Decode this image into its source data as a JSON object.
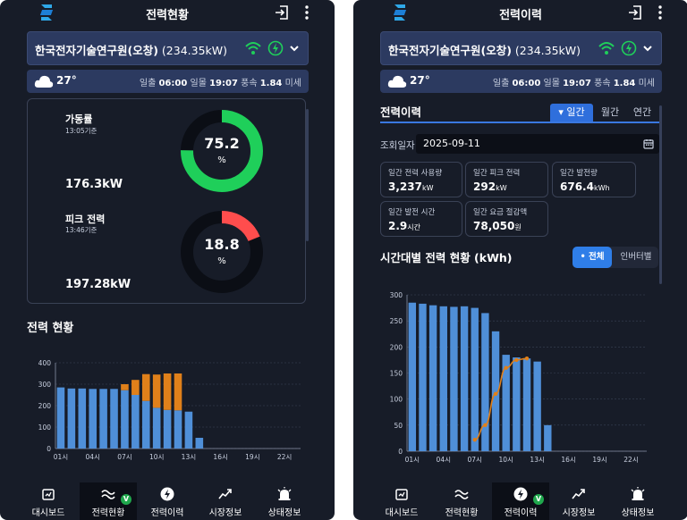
{
  "common": {
    "site_name_bold": "한국전자기술연구원(오창)",
    "site_capacity": " (234.35kW)",
    "temperature": "27°",
    "sunrise_label": "일출",
    "sunrise": "06:00",
    "sunset_label": "일몰",
    "sunset": "19:07",
    "wind_label": "풍속",
    "wind": "1.84",
    "dust_label": "미세",
    "colors": {
      "bg": "#171c28",
      "card": "#2c3a60",
      "accent": "#2f7ee8",
      "green": "#1fcf5a",
      "red": "#ff4d4d",
      "bar_blue": "#4f8fd8",
      "bar_orange": "#e0801a"
    }
  },
  "nav": {
    "items": [
      {
        "label": "대시보드",
        "icon": "dashboard-icon"
      },
      {
        "label": "전력현황",
        "icon": "power-wave-icon"
      },
      {
        "label": "전력이력",
        "icon": "bolt-icon"
      },
      {
        "label": "시장정보",
        "icon": "trend-icon"
      },
      {
        "label": "상태정보",
        "icon": "alarm-bell-icon"
      }
    ],
    "badge": "V"
  },
  "left": {
    "title": "전력현황",
    "uptime": {
      "label": "가동률",
      "time": "13:05기준",
      "value_text": "176.3kW",
      "percent": "75.2",
      "unit": "%",
      "fraction": 0.752
    },
    "peak": {
      "label": "피크 전력",
      "time": "13:46기준",
      "value_text": "197.28kW",
      "percent": "18.8",
      "unit": "%",
      "fraction": 0.188
    },
    "chart_title": "전력 현황"
  },
  "right": {
    "title": "전력이력",
    "section": "전력이력",
    "period_tabs": [
      "일간",
      "월간",
      "연간"
    ],
    "date_label": "조회일자",
    "date_value": "2025-09-11",
    "stats": [
      {
        "label": "일간 전력 사용량",
        "value": "3,237",
        "unit": "kW"
      },
      {
        "label": "일간 피크 전력",
        "value": "292",
        "unit": "kW"
      },
      {
        "label": "일간 발전량",
        "value": "676.4",
        "unit": "kWh"
      },
      {
        "label": "일간 발전 시간",
        "value": "2.9",
        "unit": "시간"
      },
      {
        "label": "일간 요금 절감액",
        "value": "78,050",
        "unit": "원"
      }
    ],
    "chart_title": "시간대별 전력 현황 (kWh)",
    "toggle": [
      "전체",
      "인버터별"
    ]
  },
  "chart_data": [
    {
      "type": "bar",
      "x": [
        "01시",
        "02시",
        "03시",
        "04시",
        "05시",
        "06시",
        "07시",
        "08시",
        "09시",
        "10시",
        "11시",
        "12시",
        "13시",
        "14시",
        "15시",
        "16시",
        "17시",
        "18시",
        "19시",
        "20시",
        "21시",
        "22시",
        "23시"
      ],
      "xticks": [
        "01시",
        "04시",
        "07시",
        "10시",
        "13시",
        "16시",
        "19시",
        "22시"
      ],
      "ylim": [
        0,
        400
      ],
      "yticks": [
        0,
        100,
        200,
        300,
        400
      ],
      "series": [
        {
          "values": [
            285,
            280,
            280,
            278,
            278,
            278,
            272,
            250,
            222,
            190,
            180,
            178,
            172,
            50,
            0,
            0,
            0,
            0,
            0,
            0,
            0,
            0,
            0
          ],
          "color": "#4f8fd8"
        },
        {
          "values": [
            0,
            0,
            0,
            0,
            0,
            0,
            28,
            70,
            125,
            155,
            170,
            172,
            0,
            0,
            0,
            0,
            0,
            0,
            0,
            0,
            0,
            0,
            0
          ],
          "color": "#e0801a"
        }
      ]
    },
    {
      "type": "bar",
      "x": [
        "01시",
        "02시",
        "03시",
        "04시",
        "05시",
        "06시",
        "07시",
        "08시",
        "09시",
        "10시",
        "11시",
        "12시",
        "13시",
        "14시",
        "15시",
        "16시",
        "17시",
        "18시",
        "19시",
        "20시",
        "21시",
        "22시",
        "23시"
      ],
      "xticks": [
        "01시",
        "04시",
        "07시",
        "10시",
        "13시",
        "16시",
        "19시",
        "22시"
      ],
      "ylim": [
        0,
        300
      ],
      "yticks": [
        0,
        50,
        100,
        150,
        200,
        250,
        300
      ],
      "series": [
        {
          "values": [
            285,
            283,
            280,
            278,
            277,
            278,
            275,
            265,
            230,
            185,
            180,
            178,
            172,
            50,
            0,
            0,
            0,
            0,
            0,
            0,
            0,
            0,
            0
          ],
          "color": "#4f8fd8"
        },
        {
          "type": "line",
          "values": [
            null,
            null,
            null,
            null,
            null,
            null,
            22,
            50,
            110,
            160,
            175,
            178,
            null,
            null,
            null,
            null,
            null,
            null,
            null,
            null,
            null,
            null,
            null
          ],
          "color": "#e0801a"
        }
      ]
    }
  ]
}
